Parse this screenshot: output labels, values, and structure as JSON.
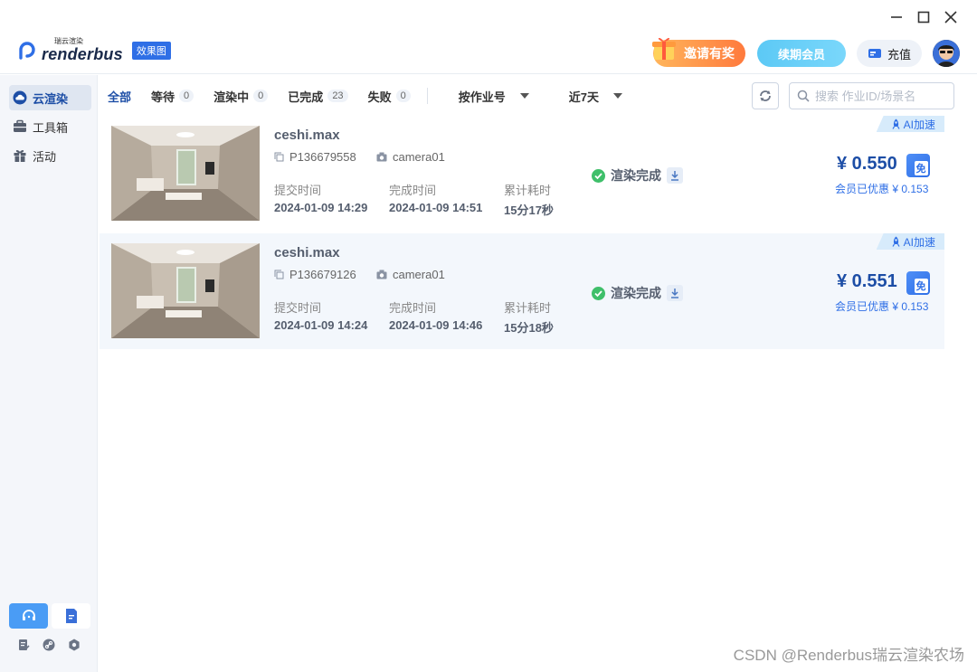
{
  "window": {
    "minimize_icon": "minimize-icon",
    "maximize_icon": "maximize-icon",
    "close_icon": "close-icon"
  },
  "header": {
    "logo_small": "瑞云渲染",
    "logo_text": "renderbus",
    "logo_tag": "效果图",
    "invite_label": "邀请有奖",
    "renew_label": "续期会员",
    "recharge_label": "充值"
  },
  "sidebar": {
    "items": [
      {
        "label": "云渲染",
        "icon": "cloud-icon",
        "active": true
      },
      {
        "label": "工具箱",
        "icon": "toolbox-icon",
        "active": false
      },
      {
        "label": "活动",
        "icon": "gift-icon",
        "active": false
      }
    ]
  },
  "filters": {
    "all": "全部",
    "waiting": {
      "label": "等待",
      "count": "0"
    },
    "rendering": {
      "label": "渲染中",
      "count": "0"
    },
    "done": {
      "label": "已完成",
      "count": "23"
    },
    "failed": {
      "label": "失败",
      "count": "0"
    },
    "sort_by": "按作业号",
    "range": "近7天"
  },
  "search": {
    "placeholder": "搜索 作业ID/场景名"
  },
  "labels": {
    "submit": "提交时间",
    "finish": "完成时间",
    "duration": "累计耗时",
    "ai": "AI加速",
    "free": "免"
  },
  "jobs": [
    {
      "name": "ceshi.max",
      "id": "P136679558",
      "camera": "camera01",
      "submit_time": "2024-01-09 14:29",
      "finish_time": "2024-01-09 14:51",
      "duration": "15分17秒",
      "status": "渲染完成",
      "price": "¥ 0.550",
      "member_discount": "会员已优惠 ¥ 0.153"
    },
    {
      "name": "ceshi.max",
      "id": "P136679126",
      "camera": "camera01",
      "submit_time": "2024-01-09 14:24",
      "finish_time": "2024-01-09 14:46",
      "duration": "15分18秒",
      "status": "渲染完成",
      "price": "¥ 0.551",
      "member_discount": "会员已优惠 ¥ 0.153"
    }
  ],
  "watermark": "CSDN @Renderbus瑞云渲染农场",
  "colors": {
    "accent": "#1d4ea6",
    "brand": "#2f6fe6",
    "success": "#3fbf6a"
  }
}
